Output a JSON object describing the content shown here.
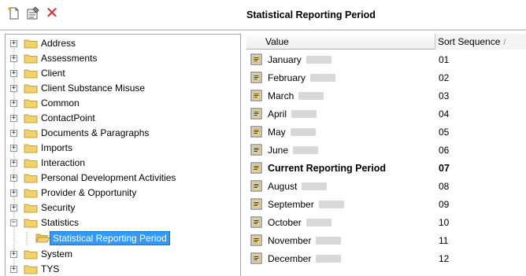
{
  "toolbar": {
    "new_icon": "new-document-icon",
    "properties_icon": "properties-icon",
    "delete_icon": "delete-x-icon",
    "delete_glyph": "✕"
  },
  "panel_title": "Statistical Reporting Period",
  "tree": {
    "items": [
      {
        "label": "Address",
        "expander": "+"
      },
      {
        "label": "Assessments",
        "expander": "+"
      },
      {
        "label": "Client",
        "expander": "+"
      },
      {
        "label": "Client Substance Misuse",
        "expander": "+"
      },
      {
        "label": "Common",
        "expander": "+"
      },
      {
        "label": "ContactPoint",
        "expander": "+"
      },
      {
        "label": "Documents & Paragraphs",
        "expander": "+"
      },
      {
        "label": "Imports",
        "expander": "+"
      },
      {
        "label": "Interaction",
        "expander": "+"
      },
      {
        "label": "Personal Development Activities",
        "expander": "+"
      },
      {
        "label": "Provider & Opportunity",
        "expander": "+"
      },
      {
        "label": "Security",
        "expander": "+"
      },
      {
        "label": "Statistics",
        "expander": "−"
      },
      {
        "label": "System",
        "expander": "+"
      },
      {
        "label": "TYS",
        "expander": "+"
      }
    ],
    "selected_child": "Statistical Reporting Period"
  },
  "grid": {
    "columns": {
      "value": "Value",
      "sort": "Sort Sequence",
      "sort_indicator": "/"
    },
    "rows": [
      {
        "value": "January",
        "seq": "01",
        "bold": false
      },
      {
        "value": "February",
        "seq": "02",
        "bold": false
      },
      {
        "value": "March",
        "seq": "03",
        "bold": false
      },
      {
        "value": "April",
        "seq": "04",
        "bold": false
      },
      {
        "value": "May",
        "seq": "05",
        "bold": false
      },
      {
        "value": "June",
        "seq": "06",
        "bold": false
      },
      {
        "value": "Current Reporting Period",
        "seq": "07",
        "bold": true
      },
      {
        "value": "August",
        "seq": "08",
        "bold": false
      },
      {
        "value": "September",
        "seq": "09",
        "bold": false
      },
      {
        "value": "October",
        "seq": "10",
        "bold": false
      },
      {
        "value": "November",
        "seq": "11",
        "bold": false
      },
      {
        "value": "December",
        "seq": "12",
        "bold": false
      }
    ]
  },
  "colors": {
    "selection": "#3399ff",
    "folder": "#f2d36b",
    "delete": "#d32a2a"
  }
}
